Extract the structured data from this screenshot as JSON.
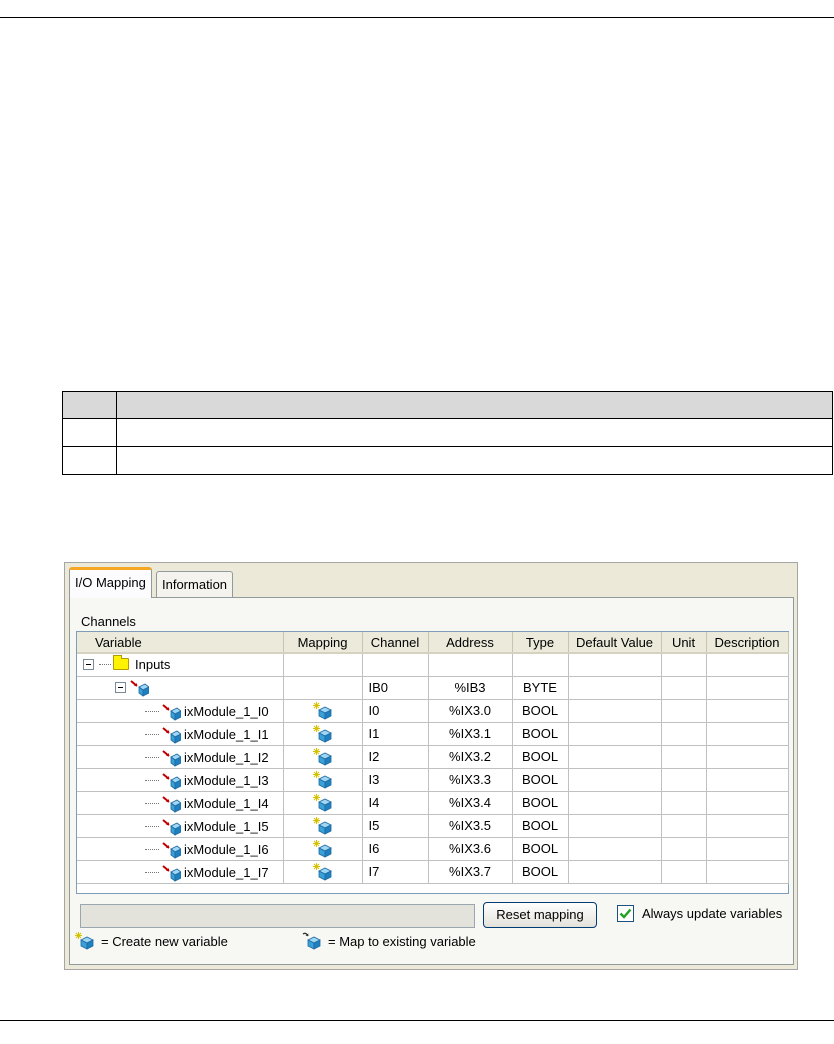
{
  "tabs": [
    {
      "label": "I/O Mapping",
      "active": true
    },
    {
      "label": "Information",
      "active": false
    }
  ],
  "channels_label": "Channels",
  "columns": [
    "Variable",
    "Mapping",
    "Channel",
    "Address",
    "Type",
    "Default Value",
    "Unit",
    "Description"
  ],
  "root_folder": {
    "label": "Inputs"
  },
  "byte_row": {
    "channel": "IB0",
    "address": "%IB3",
    "type": "BYTE"
  },
  "rows": [
    {
      "variable": "ixModule_1_I0",
      "channel": "I0",
      "address": "%IX3.0",
      "type": "BOOL"
    },
    {
      "variable": "ixModule_1_I1",
      "channel": "I1",
      "address": "%IX3.1",
      "type": "BOOL"
    },
    {
      "variable": "ixModule_1_I2",
      "channel": "I2",
      "address": "%IX3.2",
      "type": "BOOL"
    },
    {
      "variable": "ixModule_1_I3",
      "channel": "I3",
      "address": "%IX3.3",
      "type": "BOOL"
    },
    {
      "variable": "ixModule_1_I4",
      "channel": "I4",
      "address": "%IX3.4",
      "type": "BOOL"
    },
    {
      "variable": "ixModule_1_I5",
      "channel": "I5",
      "address": "%IX3.5",
      "type": "BOOL"
    },
    {
      "variable": "ixModule_1_I6",
      "channel": "I6",
      "address": "%IX3.6",
      "type": "BOOL"
    },
    {
      "variable": "ixModule_1_I7",
      "channel": "I7",
      "address": "%IX3.7",
      "type": "BOOL"
    }
  ],
  "buttons": {
    "reset_mapping": "Reset mapping"
  },
  "always_update": {
    "label": "Always update variables",
    "checked": true
  },
  "legend": {
    "create_new": "= Create new variable",
    "map_existing": "= Map to existing variable"
  },
  "icons": {
    "create_new": "create-new-variable-icon",
    "map_existing": "map-existing-variable-icon",
    "folder": "folder-icon",
    "check": "check-icon"
  },
  "colors": {
    "cube": "#3aa0d8",
    "arrow_red": "#c00000",
    "folder": "#fff300",
    "tab_accent": "#f5a623",
    "check_green": "#21a121"
  }
}
